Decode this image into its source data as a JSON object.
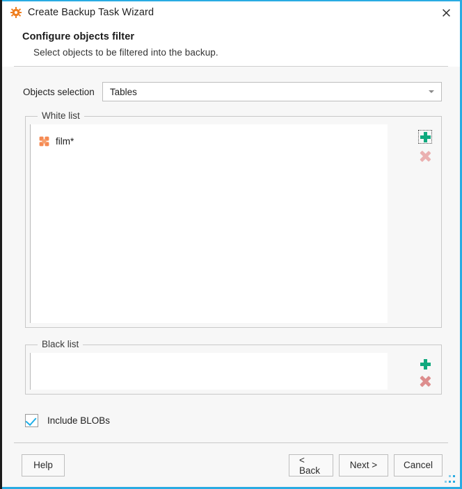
{
  "window": {
    "title": "Create Backup Task Wizard",
    "title_icon": "gear-icon",
    "close_icon": "close-icon",
    "accent_color": "#29abe2"
  },
  "header": {
    "title": "Configure objects filter",
    "subtitle": "Select objects to be filtered into the backup."
  },
  "objects_selection": {
    "label": "Objects selection",
    "value": "Tables",
    "placeholder": "Tables",
    "options": [
      "Tables"
    ],
    "arrow_icon": "chevron-down-icon"
  },
  "white_list": {
    "title": "White list",
    "items": [
      {
        "label": "film*",
        "icon": "table-object-icon",
        "icon_color": "#f58a53"
      }
    ],
    "add_label": "+",
    "remove_label": "✕",
    "add_icon": "plus-icon",
    "remove_icon": "cross-remove-icon",
    "add_color": "#0fa97e",
    "remove_color": "#eab0b0"
  },
  "black_list": {
    "title": "Black list",
    "items": [],
    "add_label": "+",
    "remove_label": "✕",
    "add_icon": "plus-icon",
    "remove_icon": "cross-remove-icon",
    "add_color": "#0fa97e",
    "remove_color": "#dd8e8e"
  },
  "include_blobs": {
    "label": "Include BLOBs",
    "checked": true,
    "check_color": "#1eaee8"
  },
  "footer": {
    "help_label": "Help",
    "back_label": "< Back",
    "next_label": "Next >",
    "cancel_label": "Cancel"
  },
  "resize_grip": "resize-grip-icon"
}
